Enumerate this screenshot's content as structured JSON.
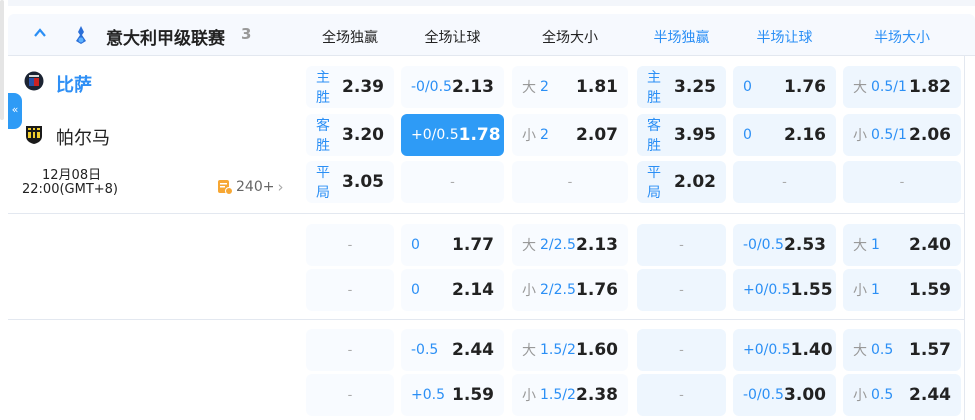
{
  "league": {
    "name": "意大利甲级联赛",
    "count": "3",
    "icon": "serie-a-logo-icon"
  },
  "columns": [
    {
      "label": "全场独赢",
      "half": false
    },
    {
      "label": "全场让球",
      "half": false
    },
    {
      "label": "全场大小",
      "half": false
    },
    {
      "label": "半场独赢",
      "half": true
    },
    {
      "label": "半场让球",
      "half": true
    },
    {
      "label": "半场大小",
      "half": true
    }
  ],
  "match": {
    "home": "比萨",
    "away": "帕尔马",
    "date": "12月08日",
    "time": "22:00(GMT+8)",
    "more": "240+"
  },
  "colors": {
    "accent": "#2e9bf6",
    "link": "#2b8ff5"
  },
  "groups": [
    {
      "rows": [
        [
          {
            "pre": "主胜",
            "odds": "2.39"
          },
          {
            "line": "-0/0.5",
            "odds": "2.13"
          },
          {
            "pre": "大",
            "line": "2",
            "odds": "1.81"
          },
          {
            "pre": "主胜",
            "odds": "3.25"
          },
          {
            "line": "0",
            "odds": "1.76"
          },
          {
            "pre": "大",
            "line": "0.5/1",
            "odds": "1.82"
          }
        ],
        [
          {
            "pre": "客胜",
            "odds": "3.20"
          },
          {
            "line": "+0/0.5",
            "odds": "1.78",
            "selected": true
          },
          {
            "pre": "小",
            "line": "2",
            "odds": "2.07"
          },
          {
            "pre": "客胜",
            "odds": "3.95"
          },
          {
            "line": "0",
            "odds": "2.16"
          },
          {
            "pre": "小",
            "line": "0.5/1",
            "odds": "2.06"
          }
        ],
        [
          {
            "pre": "平局",
            "odds": "3.05"
          },
          {
            "dash": "-"
          },
          {
            "dash": "-"
          },
          {
            "pre": "平局",
            "odds": "2.02"
          },
          {
            "dash": "-"
          },
          {
            "dash": "-"
          }
        ]
      ]
    },
    {
      "rows": [
        [
          {
            "dash": "-"
          },
          {
            "line": "0",
            "odds": "1.77"
          },
          {
            "pre": "大",
            "line": "2/2.5",
            "odds": "2.13"
          },
          {
            "dash": "-"
          },
          {
            "line": "-0/0.5",
            "odds": "2.53"
          },
          {
            "pre": "大",
            "line": "1",
            "odds": "2.40"
          }
        ],
        [
          {
            "dash": "-"
          },
          {
            "line": "0",
            "odds": "2.14"
          },
          {
            "pre": "小",
            "line": "2/2.5",
            "odds": "1.76"
          },
          {
            "dash": "-"
          },
          {
            "line": "+0/0.5",
            "odds": "1.55"
          },
          {
            "pre": "小",
            "line": "1",
            "odds": "1.59"
          }
        ]
      ]
    },
    {
      "rows": [
        [
          {
            "dash": "-"
          },
          {
            "line": "-0.5",
            "odds": "2.44"
          },
          {
            "pre": "大",
            "line": "1.5/2",
            "odds": "1.60"
          },
          {
            "dash": "-"
          },
          {
            "line": "+0/0.5",
            "odds": "1.40"
          },
          {
            "pre": "大",
            "line": "0.5",
            "odds": "1.57"
          }
        ],
        [
          {
            "dash": "-"
          },
          {
            "line": "+0.5",
            "odds": "1.59"
          },
          {
            "pre": "小",
            "line": "1.5/2",
            "odds": "2.38"
          },
          {
            "dash": "-"
          },
          {
            "line": "-0/0.5",
            "odds": "3.00"
          },
          {
            "pre": "小",
            "line": "0.5",
            "odds": "2.44"
          }
        ]
      ]
    }
  ]
}
